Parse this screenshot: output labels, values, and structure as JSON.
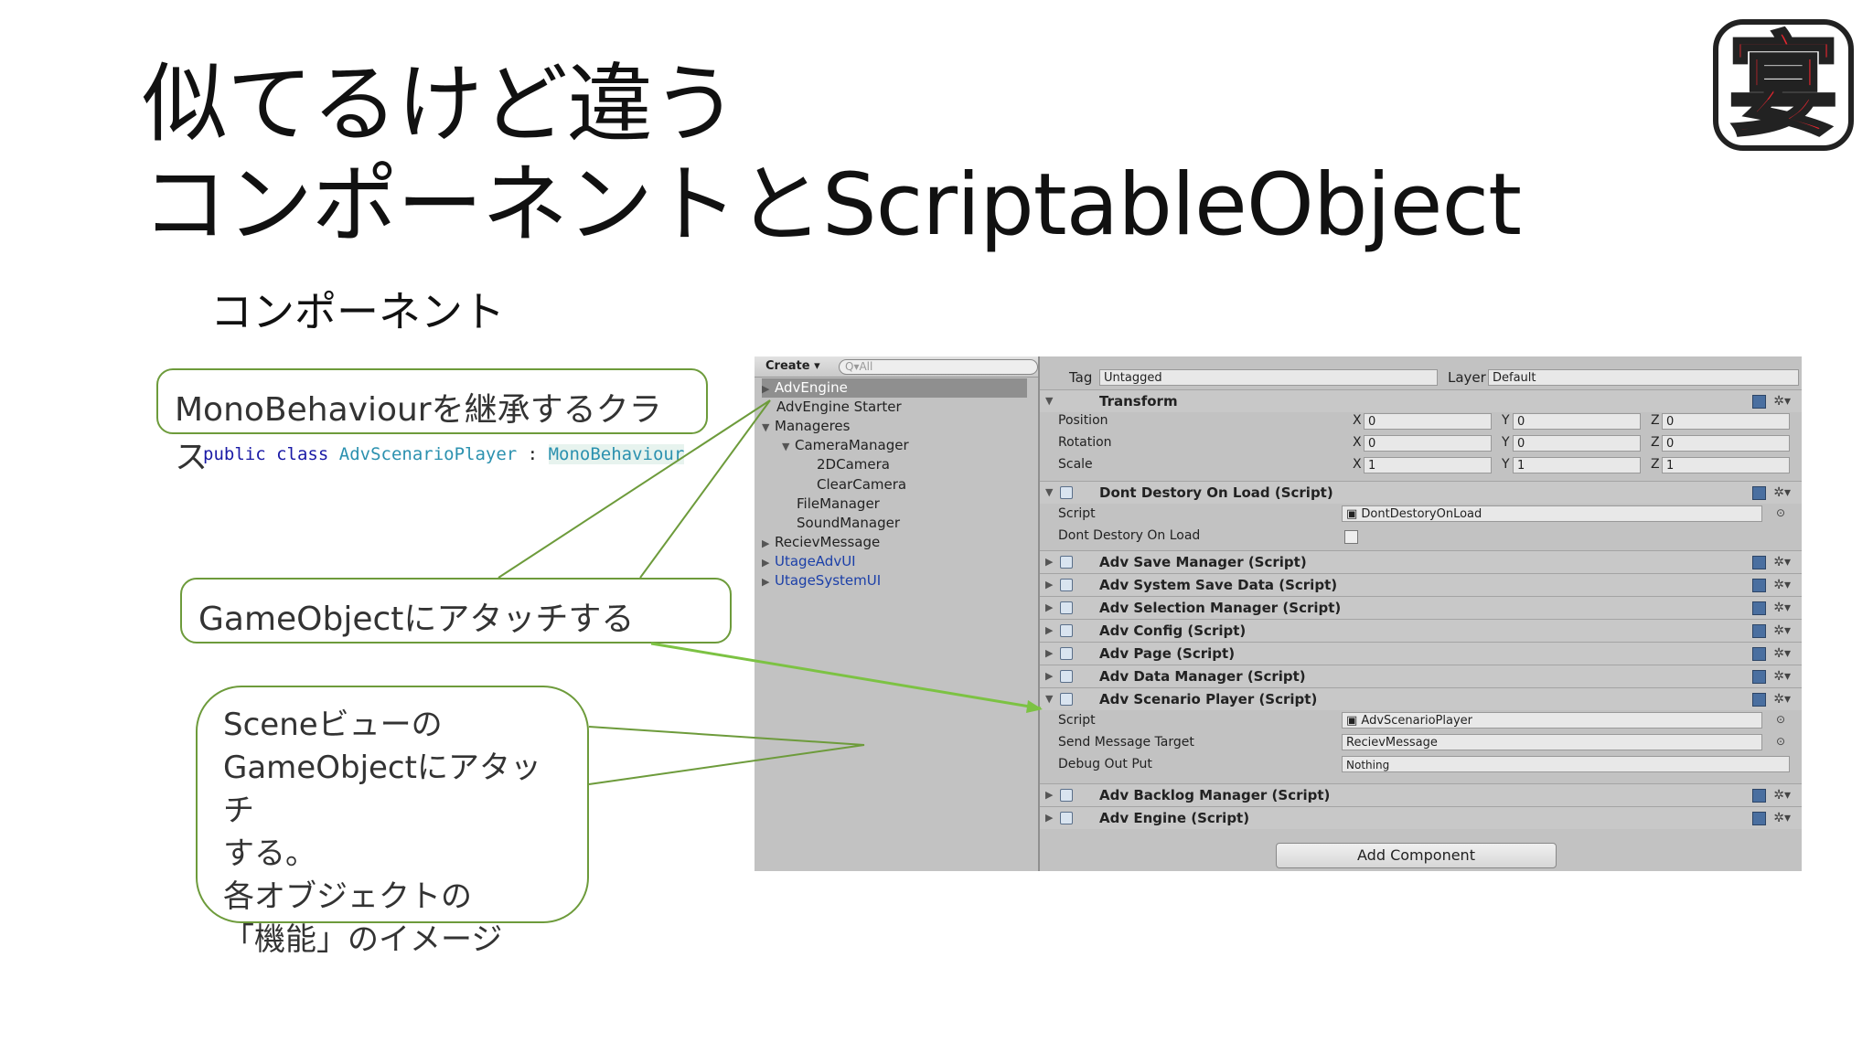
{
  "slide": {
    "title_line1": "似てるけど違う",
    "title_line2": "コンポーネントとScriptableObject",
    "subtitle": "コンポーネント",
    "callout1": "MonoBehaviourを継承するクラス",
    "callout2": "GameObjectにアタッチする",
    "callout3_lines": [
      "Sceneビューの",
      "GameObjectにアタッチ",
      "する。",
      "各オブジェクトの",
      "「機能」のイメージ"
    ],
    "code": {
      "kw1": "public",
      "kw2": "class",
      "classname": "AdvScenarioPlayer",
      "colon": ":",
      "base": "MonoBehaviour"
    },
    "logo_char": "宴",
    "logo_color": "#e8262f"
  },
  "hierarchy": {
    "create_label": "Create",
    "search_placeholder": "All",
    "items": [
      {
        "label": "AdvEngine",
        "selected": true
      },
      {
        "label": "AdvEngine Starter"
      },
      {
        "label": "Manageres"
      },
      {
        "label": "CameraManager"
      },
      {
        "label": "2DCamera"
      },
      {
        "label": "ClearCamera"
      },
      {
        "label": "FileManager"
      },
      {
        "label": "SoundManager"
      },
      {
        "label": "RecievMessage"
      },
      {
        "label": "UtageAdvUI"
      },
      {
        "label": "UtageSystemUI"
      }
    ]
  },
  "inspector": {
    "tag_label": "Tag",
    "tag_value": "Untagged",
    "layer_label": "Layer",
    "layer_value": "Default",
    "transform": {
      "name": "Transform",
      "position_label": "Position",
      "rotation_label": "Rotation",
      "scale_label": "Scale",
      "axis_x": "X",
      "axis_y": "Y",
      "axis_z": "Z",
      "position": [
        "0",
        "0",
        "0"
      ],
      "rotation": [
        "0",
        "0",
        "0"
      ],
      "scale": [
        "1",
        "1",
        "1"
      ]
    },
    "dont_destroy": {
      "name": "Dont Destory On Load (Script)",
      "script_label": "Script",
      "script_value": "DontDestoryOnLoad",
      "field_label": "Dont Destory On Load"
    },
    "collapsed_components_a": [
      "Adv Save Manager (Script)",
      "Adv System Save Data (Script)",
      "Adv Selection Manager (Script)",
      "Adv Config (Script)",
      "Adv Page (Script)",
      "Adv Data Manager (Script)"
    ],
    "scenario": {
      "name": "Adv Scenario Player (Script)",
      "script_label": "Script",
      "script_value": "AdvScenarioPlayer",
      "send_label": "Send Message Target",
      "send_value": "RecievMessage",
      "debug_label": "Debug Out Put",
      "debug_value": "Nothing"
    },
    "collapsed_components_b": [
      "Adv Backlog Manager (Script)",
      "Adv Engine (Script)"
    ],
    "add_component": "Add Component"
  },
  "colors": {
    "callout_border": "#6d9b3b",
    "arrow_color": "#7cc243",
    "prefab_blue": "#1b3fa8"
  }
}
